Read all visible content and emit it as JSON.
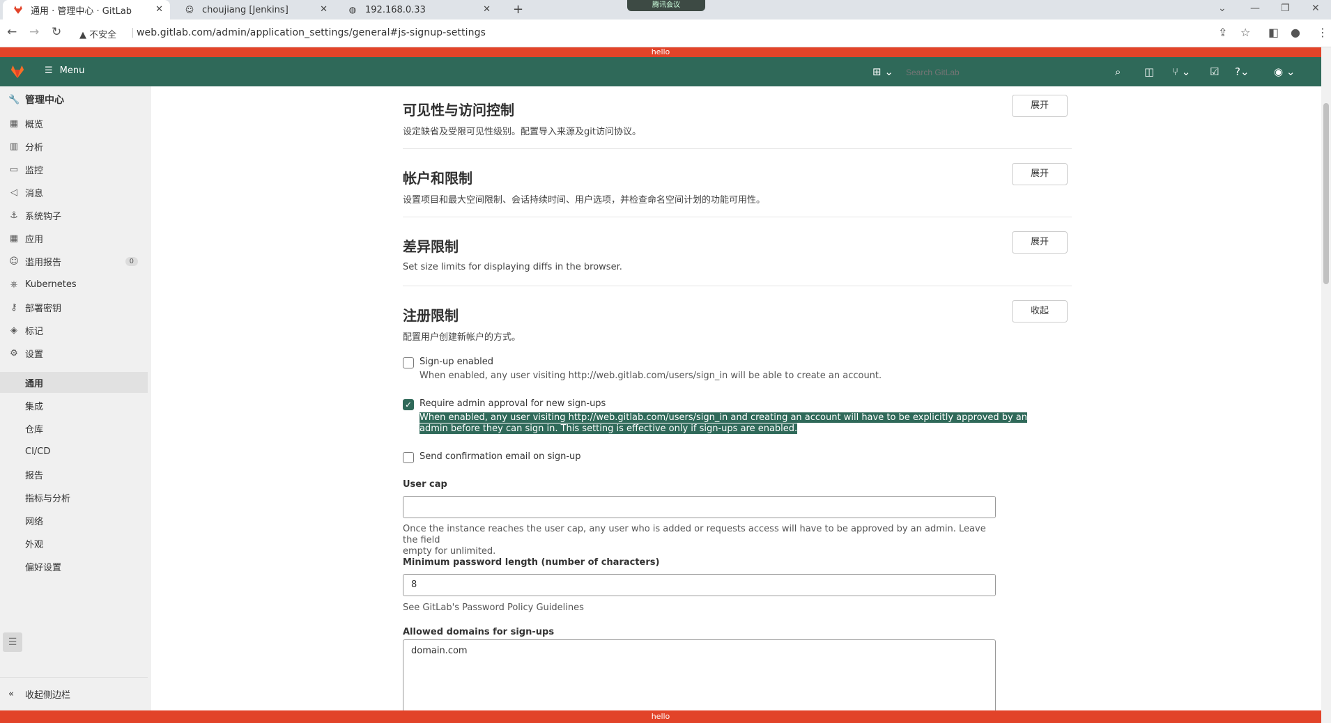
{
  "browser": {
    "tabs": [
      {
        "title": "通用 · 管理中心 · GitLab",
        "active": true
      },
      {
        "title": "choujiang [Jenkins]",
        "active": false
      },
      {
        "title": "192.168.0.33",
        "active": false
      }
    ],
    "meeting_pill": "腾讯会议",
    "insecure_label": "不安全",
    "url": "web.gitlab.com/admin/application_settings/general#js-signup-settings"
  },
  "banners": {
    "top": "hello",
    "bottom": "hello"
  },
  "topnav": {
    "menu_label": "Menu",
    "search_placeholder": "Search GitLab",
    "brand_color": "#2f6959"
  },
  "sidebar": {
    "header": "管理中心",
    "items": [
      {
        "label": "概览",
        "icon": "overview-icon"
      },
      {
        "label": "分析",
        "icon": "chart-icon"
      },
      {
        "label": "监控",
        "icon": "monitor-icon"
      },
      {
        "label": "消息",
        "icon": "bullhorn-icon"
      },
      {
        "label": "系统钩子",
        "icon": "hook-icon"
      },
      {
        "label": "应用",
        "icon": "apps-icon"
      },
      {
        "label": "滥用报告",
        "icon": "abuse-icon",
        "badge": "0"
      },
      {
        "label": "Kubernetes",
        "icon": "kubernetes-icon"
      },
      {
        "label": "部署密钥",
        "icon": "key-icon"
      },
      {
        "label": "标记",
        "icon": "label-icon"
      },
      {
        "label": "设置",
        "icon": "gear-icon"
      }
    ],
    "settings_sub": [
      "通用",
      "集成",
      "仓库",
      "CI/CD",
      "报告",
      "指标与分析",
      "网络",
      "外观",
      "偏好设置"
    ],
    "collapse_label": "收起侧边栏"
  },
  "sections": [
    {
      "title": "可见性与访问控制",
      "desc": "设定缺省及受限可见性级别。配置导入来源及git访问协议。",
      "button": "展开"
    },
    {
      "title": "帐户和限制",
      "desc": "设置项目和最大空间限制、会话持续时间、用户选项，并检查命名空间计划的功能可用性。",
      "button": "展开"
    },
    {
      "title": "差异限制",
      "desc": "Set size limits for displaying diffs in the browser.",
      "button": "展开"
    },
    {
      "title": "注册限制",
      "desc": "配置用户创建新帐户的方式。",
      "button": "收起"
    }
  ],
  "signup": {
    "signup_enabled": {
      "label": "Sign-up enabled",
      "checked": false,
      "help": "When enabled, any user visiting http://web.gitlab.com/users/sign_in will be able to create an account."
    },
    "require_admin": {
      "label": "Require admin approval for new sign-ups",
      "checked": true,
      "help_line1": "When enabled, any user visiting http://web.gitlab.com/users/sign_in and creating an account will have to be explicitly approved by an",
      "help_line2": "admin before they can sign in. This setting is effective only if sign-ups are enabled."
    },
    "send_confirmation": {
      "label": "Send confirmation email on sign-up",
      "checked": false
    },
    "user_cap": {
      "label": "User cap",
      "value": "",
      "help_line1": "Once the instance reaches the user cap, any user who is added or requests access will have to be approved by an admin. Leave the field",
      "help_line2": "empty for unlimited."
    },
    "min_password": {
      "label": "Minimum password length (number of characters)",
      "value": "8",
      "help": "See GitLab's Password Policy Guidelines"
    },
    "allowed_domains": {
      "label": "Allowed domains for sign-ups",
      "value": "domain.com"
    }
  }
}
